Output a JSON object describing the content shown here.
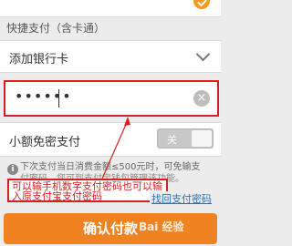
{
  "section_title": "快捷支付（含卡通）",
  "bank_row": {
    "label": "添加银行卡"
  },
  "password": {
    "value": "••••••",
    "clear_glyph": "×"
  },
  "switch_row": {
    "label": "小额免密支付",
    "toggle_text": "关",
    "state": "off"
  },
  "info": {
    "icon_glyph": "i",
    "line1": "下次支付当日消费金额≤500元时，可免输支",
    "line2": "付密码。您可到支付宝钱包管理该功能。"
  },
  "annotation": {
    "line1": "可以输手机数字支付密码也可以输",
    "line2": "入原支付宝支付密码"
  },
  "find_password_link": "找回支付密码",
  "confirm_button": "确认付款",
  "watermark": "Bai 经验",
  "colors": {
    "accent": "#f08222",
    "annotation": "#d62020",
    "link": "#2a6ebb"
  }
}
